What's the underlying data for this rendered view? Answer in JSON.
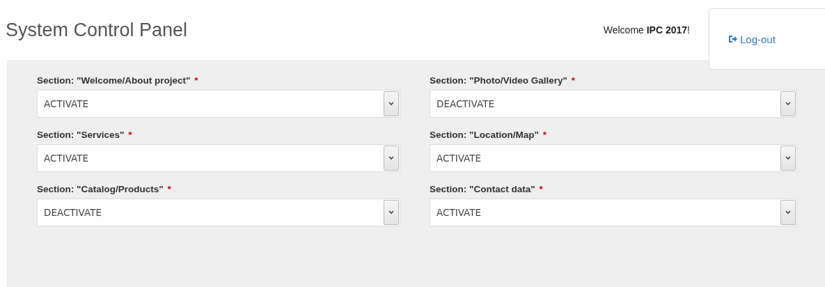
{
  "header": {
    "title": "System Control Panel",
    "welcome": "Welcome **IPC 2017**!",
    "logout_button": "Log-out"
  },
  "fields": [
    {
      "label": "Section: \"Welcome/About project\"",
      "required_mark": "*",
      "value": "ACTIVATE"
    },
    {
      "label": "Section: \"Photo/Video Gallery\"",
      "required_mark": "*",
      "value": "DEACTIVATE"
    },
    {
      "label": "Section: \"Services\"",
      "required_mark": "*",
      "value": "ACTIVATE"
    },
    {
      "label": "Section: \"Location/Map\"",
      "required_mark": "*",
      "value": "ACTIVATE"
    },
    {
      "label": "Section: \"Catalog/Products\"",
      "required_mark": "*",
      "value": "DEACTIVATE"
    },
    {
      "label": "Section: \"Contact data\"",
      "required_mark": "*",
      "value": "ACTIVATE"
    }
  ]
}
